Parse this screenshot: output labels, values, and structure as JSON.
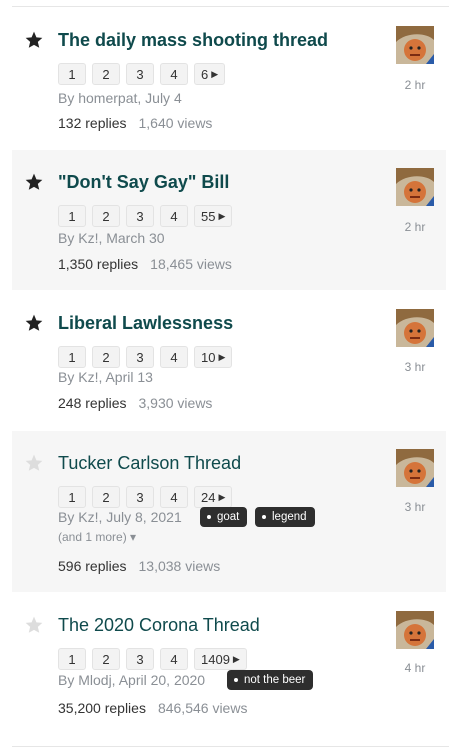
{
  "topics": [
    {
      "title": "The daily mass shooting thread",
      "starred": true,
      "bold": true,
      "pages": [
        "1",
        "2",
        "3",
        "4",
        "6"
      ],
      "author": "By homerpat, July 4",
      "more": "",
      "tags": [],
      "replies": "132 replies",
      "views": "1,640 views",
      "time": "2 hr"
    },
    {
      "title": "\"Don't Say Gay\" Bill",
      "starred": true,
      "bold": true,
      "pages": [
        "1",
        "2",
        "3",
        "4",
        "55"
      ],
      "author": "By Kz!, March 30",
      "more": "",
      "tags": [],
      "replies": "1,350 replies",
      "views": "18,465 views",
      "time": "2 hr"
    },
    {
      "title": "Liberal Lawlessness",
      "starred": true,
      "bold": true,
      "pages": [
        "1",
        "2",
        "3",
        "4",
        "10"
      ],
      "author": "By Kz!, April 13",
      "more": "",
      "tags": [],
      "replies": "248 replies",
      "views": "3,930 views",
      "time": "3 hr"
    },
    {
      "title": "Tucker Carlson Thread",
      "starred": false,
      "bold": false,
      "pages": [
        "1",
        "2",
        "3",
        "4",
        "24"
      ],
      "author": "By Kz!, July 8, 2021",
      "more": "(and 1 more)",
      "tags": [
        "goat",
        "legend"
      ],
      "replies": "596 replies",
      "views": "13,038 views",
      "time": "3 hr"
    },
    {
      "title": "The 2020 Corona Thread",
      "starred": false,
      "bold": false,
      "pages": [
        "1",
        "2",
        "3",
        "4",
        "1409"
      ],
      "author": "By Mlodj, April 20, 2020",
      "more": "",
      "tags": [
        "not the beer"
      ],
      "replies": "35,200 replies",
      "views": "846,546 views",
      "time": "4 hr"
    }
  ],
  "colors": {
    "title": "#0f4a4c",
    "star_filled": "#222222",
    "star_empty": "#dddddd",
    "tag_bg": "#2e2e2e"
  },
  "icons": {
    "star": "star-icon",
    "next_page": "caret-right-icon",
    "more": "caret-down-icon",
    "tag": "tag-dot-icon"
  }
}
